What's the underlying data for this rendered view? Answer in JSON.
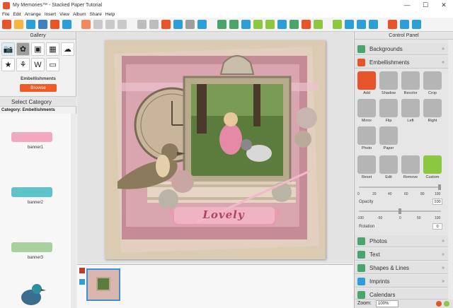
{
  "window": {
    "title": "My Memories™ - Stacked Paper Tutorial",
    "minimize": "—",
    "maximize": "☐",
    "close": "✕"
  },
  "menu": [
    "File",
    "Edit",
    "Arrange",
    "Insert",
    "View",
    "Album",
    "Share",
    "Help"
  ],
  "gallery": {
    "title": "Gallery",
    "section_label": "Embellishments",
    "browse_label": "Browse",
    "select_category": "Select Category",
    "category_text": "Category: Embellishments",
    "items": [
      {
        "label": "banner1",
        "color": "#f2a9bf"
      },
      {
        "label": "banner2",
        "color": "#5fc3cc"
      },
      {
        "label": "banner3",
        "color": "#a9cf9f"
      }
    ]
  },
  "page_title_text": "Lovely",
  "control_panel": {
    "title": "Control Panel",
    "sections_top": [
      {
        "label": "Backgrounds",
        "icon": "image-icon",
        "color": "#4aa56b"
      },
      {
        "label": "Embellishments",
        "icon": "flower-icon",
        "color": "#e8542a"
      }
    ],
    "embellishment_tools": [
      {
        "label": "Add",
        "color": "#e8542a"
      },
      {
        "label": "Shadow",
        "color": "#b5b5b5"
      },
      {
        "label": "Recolor",
        "color": "#b5b5b5"
      },
      {
        "label": "Crop",
        "color": "#b5b5b5"
      },
      {
        "label": "Mirror",
        "color": "#b5b5b5"
      },
      {
        "label": "Flip",
        "color": "#b5b5b5"
      },
      {
        "label": "Left",
        "color": "#b5b5b5"
      },
      {
        "label": "Right",
        "color": "#b5b5b5"
      },
      {
        "label": "Photo",
        "color": "#b5b5b5"
      },
      {
        "label": "Paper",
        "color": "#b5b5b5"
      },
      {
        "label": "Reset",
        "color": "#b5b5b5"
      },
      {
        "label": "Edit",
        "color": "#b5b5b5"
      },
      {
        "label": "Remove",
        "color": "#b5b5b5"
      },
      {
        "label": "Custom",
        "color": "#8dc73f"
      }
    ],
    "opacity": {
      "label": "Opacity",
      "ticks": [
        "0",
        "20",
        "40",
        "60",
        "80",
        "100"
      ],
      "value": "100"
    },
    "rotation": {
      "label": "Rotation",
      "ticks": [
        "-100",
        "-50",
        "0",
        "50",
        "100"
      ],
      "value": "0"
    },
    "sections_bottom": [
      {
        "label": "Photos",
        "color": "#4aa56b"
      },
      {
        "label": "Text",
        "color": "#4aa56b"
      },
      {
        "label": "Shapes & Lines",
        "color": "#4aa56b"
      },
      {
        "label": "Imprints",
        "color": "#2e9fd6"
      },
      {
        "label": "Calendars",
        "color": "#4aa56b"
      }
    ],
    "zoom_label": "Zoom:",
    "zoom_value": "100%"
  }
}
